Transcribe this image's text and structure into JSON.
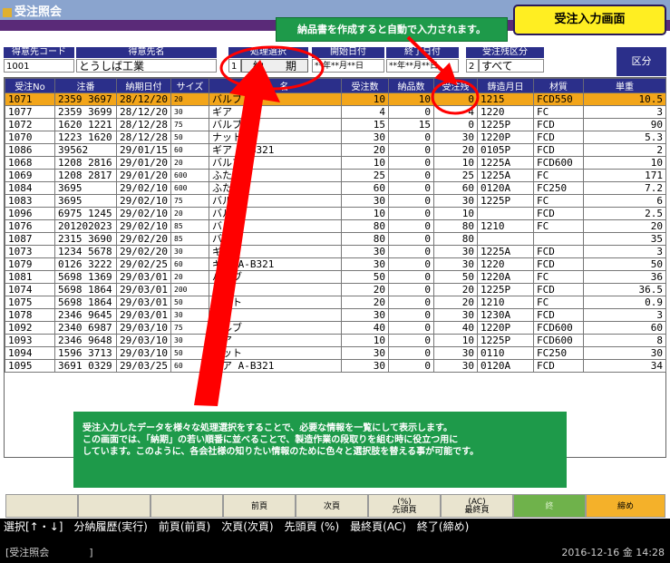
{
  "window": {
    "title": "受注照会"
  },
  "callouts": {
    "top": "納品書を作成すると自動で入力されます。",
    "bottom": [
      "受注入力したデータを様々な処理選択をすることで、必要な情報を一覧にして表示します。",
      "この画面では、「納期」の若い順番に並べることで、製造作業の段取りを組む時に役立つ用に",
      "しています。このように、各会社様の知りたい情報のために色々と選択肢を替える事が可能です。"
    ]
  },
  "screen_badge": "受注入力画面",
  "filters": {
    "customer_code_label": "得意先コード",
    "customer_code": "1001",
    "customer_name_label": "得意先名",
    "customer_name": "とうしば工業",
    "process_label": "処理選択",
    "process_no": "1",
    "process_value": "納　　期",
    "start_date_label": "開始日付",
    "start_date": "**年**月**日",
    "end_date_label": "終了日付",
    "end_date": "**年**月**日",
    "status_label": "受注残区分",
    "status_no": "2",
    "status_value": "すべて",
    "kubun_label": "区分"
  },
  "table": {
    "columns": [
      "受注No",
      "注番",
      "納期日付",
      "サイズ",
      "品　名",
      "受注数",
      "納品数",
      "受注残",
      "鋳造月日",
      "材質",
      "単重"
    ],
    "rows": [
      [
        "1071",
        "2359 3697",
        "28/12/20",
        "20",
        "バルブ",
        "10",
        "10",
        "0",
        "1215",
        "FCD550",
        "10.5"
      ],
      [
        "1077",
        "2359 3699",
        "28/12/20",
        "30",
        "ギア",
        "4",
        "0",
        "4",
        "1220",
        "FC",
        "3"
      ],
      [
        "1072",
        "1620 1221",
        "28/12/28",
        "75",
        "バルブ",
        "15",
        "15",
        "0",
        "1225P",
        "FCD",
        "90"
      ],
      [
        "1070",
        "1223 1620",
        "28/12/28",
        "50",
        "ナット",
        "30",
        "0",
        "30",
        "1220P",
        "FCD",
        "5.3"
      ],
      [
        "1086",
        "39562",
        "29/01/15",
        "60",
        "ギア A-B321",
        "20",
        "0",
        "20",
        "0105P",
        "FCD",
        "2"
      ],
      [
        "1068",
        "1208 2816",
        "29/01/20",
        "20",
        "バルブ",
        "10",
        "0",
        "10",
        "1225A",
        "FCD600",
        "10"
      ],
      [
        "1069",
        "1208 2817",
        "29/01/20",
        "600",
        "ふた",
        "25",
        "0",
        "25",
        "1225A",
        "FC",
        "171"
      ],
      [
        "1084",
        "3695",
        "29/02/10",
        "600",
        "ふた",
        "60",
        "0",
        "60",
        "0120A",
        "FC250",
        "7.2"
      ],
      [
        "1083",
        "3695",
        "29/02/10",
        "75",
        "バルブ",
        "30",
        "0",
        "30",
        "1225P",
        "FC",
        "6"
      ],
      [
        "1096",
        "6975 1245",
        "29/02/10",
        "20",
        "バルブ",
        "10",
        "0",
        "10",
        "",
        "FCD",
        "2.5"
      ],
      [
        "1076",
        "201202023",
        "29/02/10",
        "85",
        "バルブ",
        "80",
        "0",
        "80",
        "1210",
        "FC",
        "20"
      ],
      [
        "1087",
        "2315 3690",
        "29/02/20",
        "85",
        "バルブ",
        "80",
        "0",
        "80",
        "",
        "",
        "35"
      ],
      [
        "1073",
        "1234 5678",
        "29/02/20",
        "30",
        "ギア",
        "30",
        "0",
        "30",
        "1225A",
        "FCD",
        "3"
      ],
      [
        "1079",
        "0126 3222",
        "29/02/25",
        "60",
        "ギア A-B321",
        "30",
        "0",
        "30",
        "1220",
        "FCD",
        "50"
      ],
      [
        "1081",
        "5698 1369",
        "29/03/01",
        "20",
        "バルブ",
        "50",
        "0",
        "50",
        "1220A",
        "FC",
        "36"
      ],
      [
        "1074",
        "5698 1864",
        "29/03/01",
        "200",
        "ふた",
        "20",
        "0",
        "20",
        "1225P",
        "FCD",
        "36.5"
      ],
      [
        "1075",
        "5698 1864",
        "29/03/01",
        "50",
        "ナット",
        "20",
        "0",
        "20",
        "1210",
        "FC",
        "0.9"
      ],
      [
        "1078",
        "2346 9645",
        "29/03/01",
        "30",
        "ギア",
        "30",
        "0",
        "30",
        "1230A",
        "FCD",
        "3"
      ],
      [
        "1092",
        "2340 6987",
        "29/03/10",
        "75",
        "バルブ",
        "40",
        "0",
        "40",
        "1220P",
        "FCD600",
        "60"
      ],
      [
        "1093",
        "2346 9648",
        "29/03/10",
        "30",
        "ギア",
        "10",
        "0",
        "10",
        "1225P",
        "FCD600",
        "8"
      ],
      [
        "1094",
        "1596 3713",
        "29/03/10",
        "50",
        "ナット",
        "30",
        "0",
        "30",
        "0110",
        "FC250",
        "30"
      ],
      [
        "1095",
        "3691 0329",
        "29/03/25",
        "60",
        "ギア A-B321",
        "30",
        "0",
        "30",
        "0120A",
        "FCD",
        "34"
      ]
    ]
  },
  "function_keys": [
    "",
    "",
    "",
    "前頁",
    "次頁",
    "(%)\n先頭頁",
    "(AC)\n最終頁",
    "終",
    "締め"
  ],
  "menu": "選択[↑・↓]　分納履歴(実行)　前頁(前頁)　次頁(次頁)　先頭頁 (%)　最終頁(AC)　終了(締め)",
  "status": {
    "left": "[受注照会　　　　]",
    "right": "2016-12-16 金 14:28"
  },
  "colors": {
    "header": "#2b2f8a",
    "selected_row": "#f2a51a",
    "callout": "#1e9a4a",
    "arrow": "#ff0000"
  }
}
